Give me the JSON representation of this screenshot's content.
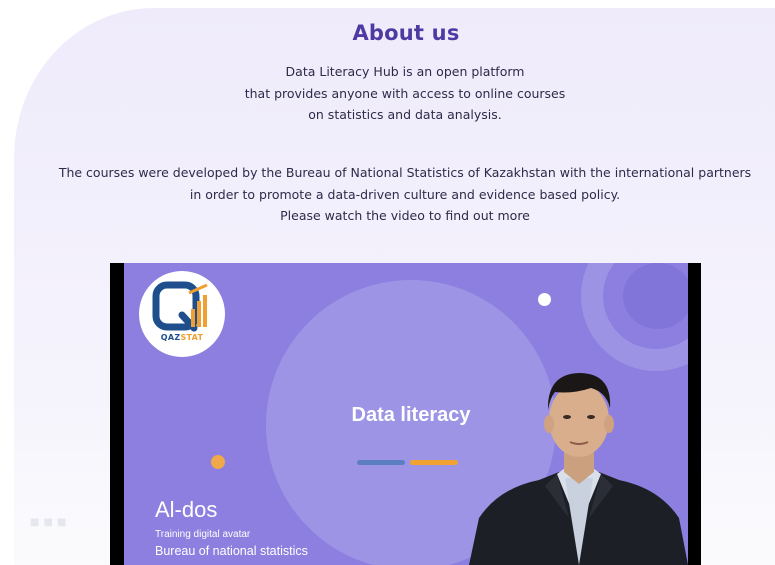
{
  "about": {
    "title": "About us",
    "intro_lines": [
      "Data Literacy Hub is an open platform",
      "that provides anyone with access to online courses",
      "on statistics and data analysis."
    ],
    "body_lines": [
      "The courses were developed by the Bureau of National Statistics of Kazakhstan with the international partners",
      "in order to promote a data-driven culture and evidence based policy.",
      "Please watch the video to find out more"
    ]
  },
  "video": {
    "logo_text_q": "QAZ",
    "logo_text_s": "STAT",
    "slide_title": "Data literacy",
    "presenter_name": "Al-dos",
    "presenter_role": "Training digital avatar",
    "presenter_org": "Bureau of national statistics"
  },
  "colors": {
    "title": "#4e3aa2",
    "slide_background": "#8c7fdf",
    "accent_orange": "#f0a232",
    "accent_blue": "#5b7fc2"
  }
}
